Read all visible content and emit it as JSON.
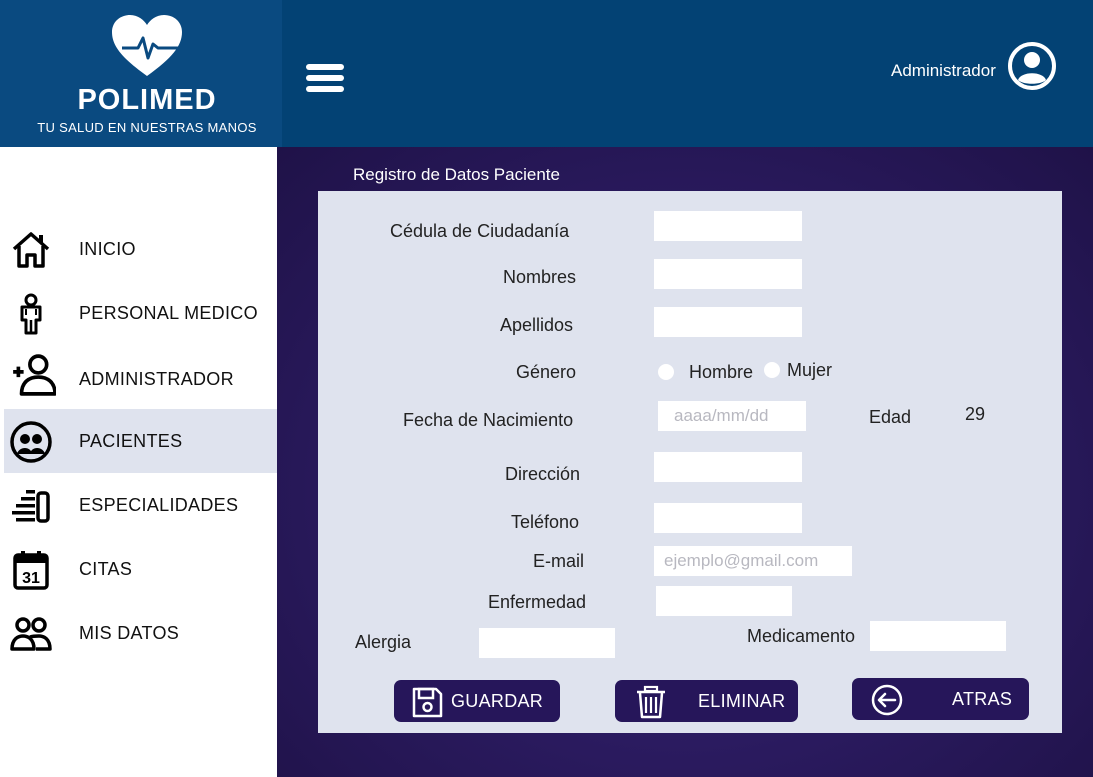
{
  "brand": {
    "name": "POLIMED",
    "tagline": "TU SALUD EN NUESTRAS MANOS",
    "color": "#034274"
  },
  "header": {
    "user_label": "Administrador"
  },
  "sidebar": {
    "items": [
      {
        "label": "INICIO",
        "icon": "home-icon"
      },
      {
        "label": "PERSONAL MEDICO",
        "icon": "doctor-icon"
      },
      {
        "label": "ADMINISTRADOR",
        "icon": "add-user-icon"
      },
      {
        "label": "PACIENTES",
        "icon": "patients-icon",
        "active": true
      },
      {
        "label": "ESPECIALIDADES",
        "icon": "specialties-icon"
      },
      {
        "label": "CITAS",
        "icon": "calendar-icon"
      },
      {
        "label": "MIS DATOS",
        "icon": "users-icon"
      }
    ],
    "calendar_day": "31"
  },
  "form": {
    "title": "Registro de Datos Paciente",
    "cedula_label": "Cédula de Ciudadanía",
    "nombres_label": "Nombres",
    "apellidos_label": "Apellidos",
    "genero_label": "Género",
    "genero_options": [
      "Hombre",
      "Mujer"
    ],
    "fecha_label": "Fecha de Nacimiento",
    "fecha_placeholder": "aaaa/mm/dd",
    "edad_label": "Edad",
    "edad_value": "29",
    "direccion_label": "Dirección",
    "telefono_label": "Teléfono",
    "email_label": "E-mail",
    "email_placeholder": "ejemplo@gmail.com",
    "enfermedad_label": "Enfermedad",
    "alergia_label": "Alergia",
    "medicamento_label": "Medicamento"
  },
  "buttons": {
    "guardar": "GUARDAR",
    "eliminar": "ELIMINAR",
    "atras": "ATRAS"
  },
  "colors": {
    "panel": "#dfe3ee",
    "main_bg": "#2a1a5e",
    "button": "#26165a"
  }
}
